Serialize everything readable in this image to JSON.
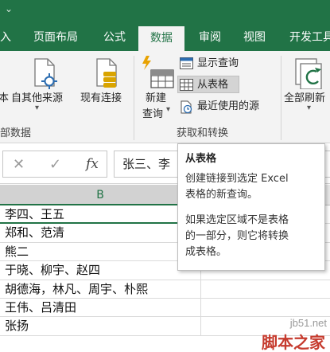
{
  "colors": {
    "accent": "#217346",
    "watermark": "#c63b2e"
  },
  "tabs": [
    {
      "label": "入",
      "active": false
    },
    {
      "label": "页面布局",
      "active": false
    },
    {
      "label": "公式",
      "active": false
    },
    {
      "label": "数据",
      "active": true
    },
    {
      "label": "审阅",
      "active": false
    },
    {
      "label": "视图",
      "active": false
    },
    {
      "label": "开发工具",
      "active": false
    }
  ],
  "ribbon": {
    "from_text_partial": "本",
    "from_other_sources": "自其他来源",
    "existing_connections": "现有连接",
    "new_query_line1": "新建",
    "new_query_line2": "查询",
    "show_queries": "显示查询",
    "from_table": "从表格",
    "recent_sources": "最近使用的源",
    "refresh_all": "全部刷新",
    "group_external_partial": "部数据",
    "group_get_transform": "获取和转换",
    "dropdown_arrow": "▾"
  },
  "formula_bar": {
    "cancel_icon": "✕",
    "enter_icon": "✓",
    "fx_label": "fx",
    "content_partial": "张三、李"
  },
  "grid": {
    "column": "B",
    "rows": [
      "李四、王五",
      "郑和、范清",
      "熊二",
      "于晓、柳宇、赵四",
      "胡德海，林凡、周宇、朴熙",
      "王伟、吕清田",
      "张扬"
    ]
  },
  "tooltip": {
    "title": "从表格",
    "line1": "创建链接到选定 Excel",
    "line2": "表格的新查询。",
    "line3": "如果选定区域不是表格",
    "line4": "的一部分，则它将转换",
    "line5": "成表格。"
  },
  "watermark": {
    "url": "jb51.net",
    "name": "脚本之家"
  }
}
